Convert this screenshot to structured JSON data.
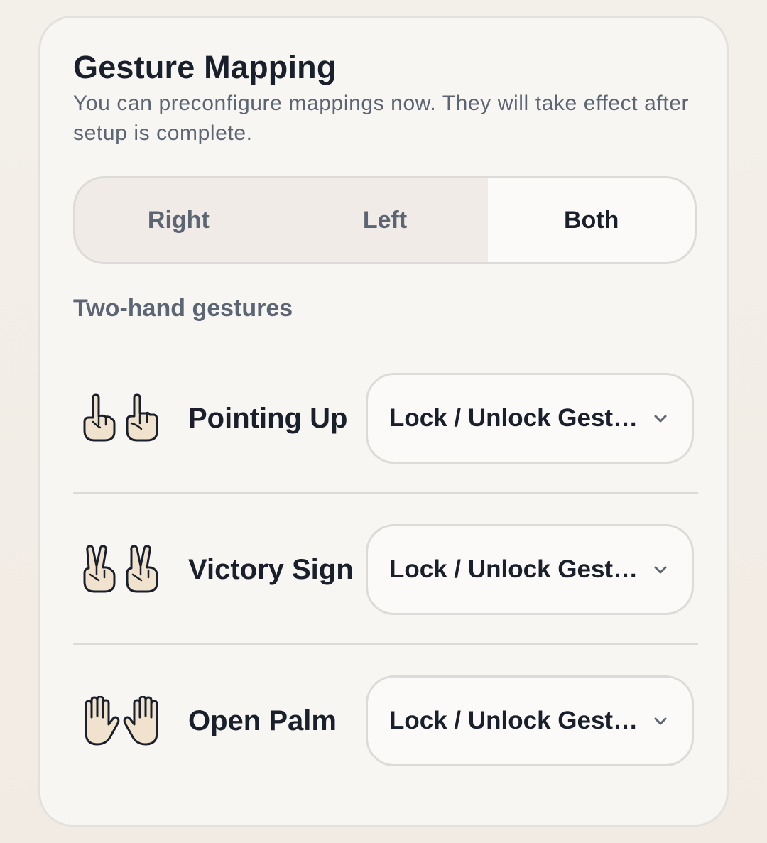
{
  "card": {
    "title": "Gesture Mapping",
    "subtitle": "You can preconfigure mappings now. They will take effect after setup is complete."
  },
  "hand_selector": {
    "options": [
      "Right",
      "Left",
      "Both"
    ],
    "selected": "Both"
  },
  "section_label": "Two-hand gestures",
  "gestures": [
    {
      "name": "Pointing Up",
      "icon": "pointing-up-icon",
      "action": "Lock / Unlock Gest…"
    },
    {
      "name": "Victory Sign",
      "icon": "victory-hand-icon",
      "action": "Lock / Unlock Gest…"
    },
    {
      "name": "Open Palm",
      "icon": "open-palm-icon",
      "action": "Lock / Unlock Gest…"
    }
  ],
  "colors": {
    "text_primary": "#19202b",
    "text_secondary": "#5b6573",
    "border": "#dcdbd8",
    "card_bg": "#f8f6f2",
    "skin": "#f1e2cd"
  }
}
